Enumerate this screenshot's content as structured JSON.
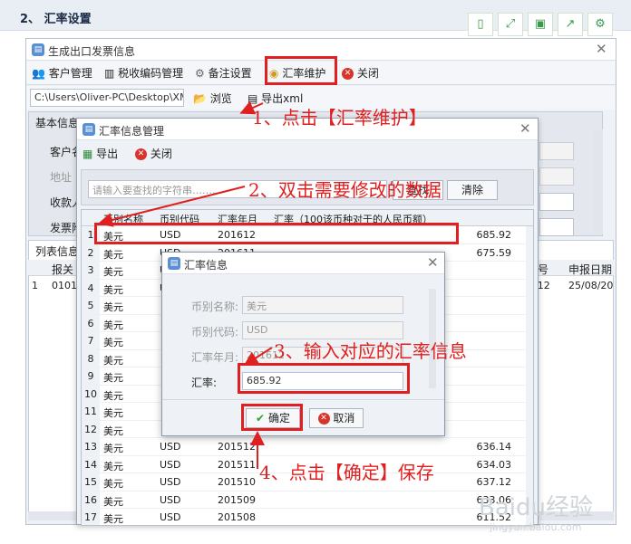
{
  "page": {
    "section_title": "2、 汇率设置"
  },
  "main_window": {
    "title": "生成出口发票信息",
    "menu": [
      "客户管理",
      "税收编码管理",
      "备注设置",
      "汇率维护",
      "关闭"
    ],
    "path_value": "C:\\Users\\Oliver-PC\\Desktop\\XML",
    "browse_label": "浏览",
    "export_xml_label": "导出xml",
    "basic_info_label": "基本信息",
    "field_labels": [
      "客户名",
      "地址",
      "收款人",
      "发票附"
    ],
    "list_label": "列表信息",
    "list_headers": [
      "报关",
      "效号",
      "申报日期"
    ],
    "list_row": {
      "no": "1",
      "cell": "0101",
      "mid": "/12",
      "date": "25/08/20"
    }
  },
  "rate_manage_dialog": {
    "title": "汇率信息管理",
    "export_label": "导出",
    "close_label": "关闭",
    "search_placeholder": "请输入要查找的字符串………",
    "query_label": "查找",
    "clear_label": "清除",
    "headers": [
      "币别名称",
      "币别代码",
      "汇率年月",
      "汇率（100该币种对于的人民币额）"
    ],
    "rows": [
      {
        "no": "1",
        "name": "美元",
        "code": "USD",
        "ym": "201612",
        "rate": "685.92"
      },
      {
        "no": "2",
        "name": "美元",
        "code": "USD",
        "ym": "201611",
        "rate": "675.59"
      },
      {
        "no": "3",
        "name": "美元",
        "code": "USD",
        "ym": "",
        "rate": ""
      },
      {
        "no": "4",
        "name": "美元",
        "code": "USD",
        "ym": "",
        "rate": ""
      },
      {
        "no": "5",
        "name": "美元",
        "code": "",
        "ym": "",
        "rate": ""
      },
      {
        "no": "6",
        "name": "美元",
        "code": "",
        "ym": "",
        "rate": ""
      },
      {
        "no": "7",
        "name": "美元",
        "code": "",
        "ym": "",
        "rate": ""
      },
      {
        "no": "8",
        "name": "美元",
        "code": "",
        "ym": "",
        "rate": ""
      },
      {
        "no": "9",
        "name": "美元",
        "code": "",
        "ym": "",
        "rate": ""
      },
      {
        "no": "10",
        "name": "美元",
        "code": "",
        "ym": "",
        "rate": ""
      },
      {
        "no": "11",
        "name": "美元",
        "code": "",
        "ym": "",
        "rate": ""
      },
      {
        "no": "12",
        "name": "美元",
        "code": "",
        "ym": "",
        "rate": ""
      },
      {
        "no": "13",
        "name": "美元",
        "code": "USD",
        "ym": "201512",
        "rate": "636.14"
      },
      {
        "no": "14",
        "name": "美元",
        "code": "USD",
        "ym": "201511",
        "rate": "634.03"
      },
      {
        "no": "15",
        "name": "美元",
        "code": "USD",
        "ym": "201510",
        "rate": "637.12"
      },
      {
        "no": "16",
        "name": "美元",
        "code": "USD",
        "ym": "201509",
        "rate": "633.06"
      },
      {
        "no": "17",
        "name": "美元",
        "code": "USD",
        "ym": "201508",
        "rate": "611.52"
      }
    ]
  },
  "rate_info_dialog": {
    "title": "汇率信息",
    "currency_name_label": "币别名称:",
    "currency_name_value": "美元",
    "currency_code_label": "币别代码:",
    "currency_code_value": "USD",
    "year_month_label": "汇率年月:",
    "year_month_value": "201612",
    "rate_label": "汇率:",
    "rate_value": "685.92",
    "ok_label": "确定",
    "cancel_label": "取消"
  },
  "annotations": {
    "step1": "1、点击【汇率维护】",
    "step2": "2、双击需要修改的数据",
    "step3": "3、输入对应的汇率信息",
    "step4": "4、点击【确定】保存"
  },
  "watermark": {
    "brand": "Baidu经验",
    "url": "jingyan.baidu.com"
  },
  "colors": {
    "annotation_red": "#e02020",
    "accent_blue": "#5b8fd3"
  }
}
